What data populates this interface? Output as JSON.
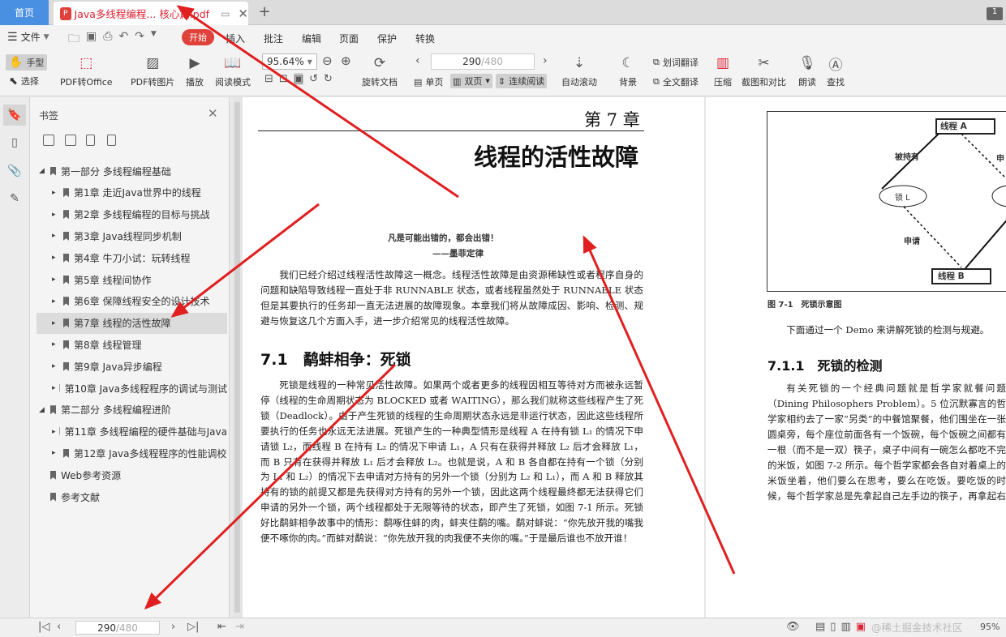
{
  "tabs": {
    "home": "首页",
    "doc_title": "Java多线程编程... 核心篇.pdf",
    "pdf_badge": "P"
  },
  "window_badge": "1",
  "menu": {
    "file": "文件",
    "items": [
      "开始",
      "插入",
      "批注",
      "编辑",
      "页面",
      "保护",
      "转换"
    ]
  },
  "toolbar": {
    "hand": "手型",
    "select": "选择",
    "pdf_to_office": "PDF转Office",
    "pdf_to_image": "PDF转图片",
    "play": "播放",
    "read_mode": "阅读模式",
    "zoom": "95.64%",
    "rotate": "旋转文档",
    "page_current": "290",
    "page_total": "/480",
    "single": "单页",
    "double": "双页",
    "continuous": "连续阅读",
    "auto_scroll": "自动滚动",
    "background": "背景",
    "word_translate": "划词翻译",
    "full_translate": "全文翻译",
    "compress": "压缩",
    "crop_compare": "截图和对比",
    "read_aloud": "朗读",
    "find": "查找"
  },
  "panel": {
    "title": "书签",
    "bookmarks": [
      {
        "label": "第一部分 多线程编程基础",
        "level": 0,
        "tri": "◢"
      },
      {
        "label": "第1章 走近Java世界中的线程",
        "level": 1,
        "tri": "▸"
      },
      {
        "label": "第2章 多线程编程的目标与挑战",
        "level": 1,
        "tri": "▸"
      },
      {
        "label": "第3章 Java线程同步机制",
        "level": 1,
        "tri": "▸"
      },
      {
        "label": "第4章 牛刀小试：玩转线程",
        "level": 1,
        "tri": "▸"
      },
      {
        "label": "第5章 线程间协作",
        "level": 1,
        "tri": "▸"
      },
      {
        "label": "第6章 保障线程安全的设计技术",
        "level": 1,
        "tri": "▸"
      },
      {
        "label": "第7章 线程的活性故障",
        "level": 1,
        "tri": "▸"
      },
      {
        "label": "第8章 线程管理",
        "level": 1,
        "tri": "▸"
      },
      {
        "label": "第9章 Java异步编程",
        "level": 1,
        "tri": "▸"
      },
      {
        "label": "第10章 Java多线程程序的调试与测试",
        "level": 1,
        "tri": "▸"
      },
      {
        "label": "第二部分 多线程编程进阶",
        "level": 0,
        "tri": "◢"
      },
      {
        "label": "第11章 多线程编程的硬件基础与Java",
        "level": 1,
        "tri": "▸"
      },
      {
        "label": "第12章 Java多线程程序的性能调校",
        "level": 1,
        "tri": "▸"
      },
      {
        "label": "Web参考资源",
        "level": 0,
        "tri": ""
      },
      {
        "label": "参考文献",
        "level": 0,
        "tri": ""
      }
    ]
  },
  "page_left": {
    "chapter": "第 7 章",
    "title": "线程的活性故障",
    "epigraph": "凡是可能出错的，都会出错！",
    "epigraph_src": "——墨菲定律",
    "intro": "我们已经介绍过线程活性故障这一概念。线程活性故障是由资源稀缺性或者程序自身的问题和缺陷导致线程一直处于非 RUNNABLE 状态，或者线程虽然处于 RUNNABLE 状态但是其要执行的任务却一直无法进展的故障现象。本章我们将从故障成因、影响、检测、规避与恢复这几个方面入手，进一步介绍常见的线程活性故障。",
    "section": "7.1　鹬蚌相争：死锁",
    "body": "死锁是线程的一种常见活性故障。如果两个或者更多的线程因相互等待对方而被永远暂停（线程的生命周期状态为 BLOCKED 或者 WAITING），那么我们就称这些线程产生了死锁（Deadlock）。由于产生死锁的线程的生命周期状态永远是非运行状态，因此这些线程所要执行的任务也永远无法进展。死锁产生的一种典型情形是线程 A 在持有锁 L₁ 的情况下申请锁 L₂，而线程 B 在持有 L₂ 的情况下申请 L₁，A 只有在获得并释放 L₂ 后才会释放 L₁，而 B 只有在获得并释放 L₁ 后才会释放 L₂。也就是说，A 和 B 各自都在持有一个锁（分别为 L₁ 和 L₂）的情况下去申请对方持有的另外一个锁（分别为 L₂ 和 L₁），而 A 和 B 释放其持有的锁的前提又都是先获得对方持有的另外一个锁，因此这两个线程最终都无法获得它们申请的另外一个锁，两个线程都处于无限等待的状态，即产生了死锁，如图 7-1 所示。死锁好比鹬蚌相争故事中的情形：鹬啄住蚌的肉，蚌夹住鹬的嘴。鹬对蚌说：“你先放开我的嘴我便不啄你的肉。”而蚌对鹬说：“你先放开我的肉我便不夹你的嘴。”于是最后谁也不放开谁！"
  },
  "page_right": {
    "diagram": {
      "thread_a": "线程 A",
      "thread_b": "线程 B",
      "lock": "锁 L",
      "held": "被持有",
      "request": "申请",
      "cut": "申"
    },
    "figure_caption": "图 7-1　死锁示意图",
    "lead": "下面通过一个 Demo 来讲解死锁的检测与规避。",
    "section": "7.1.1　死锁的检测",
    "body": "有关死锁的一个经典问题就是哲学家就餐问题（Dining Philosophers Problem）。5 位沉默寡言的哲学家相约去了一家“另类”的中餐馆聚餐，他们围坐在一张圆桌旁，每个座位前面各有一个饭碗，每个饭碗之间都有一根（而不是一双）筷子，桌子中间有一碗怎么都吃不完的米饭，如图 7-2 所示。每个哲学家都会各自对着桌上的米饭坐着，他们要么在思考，要么在吃饭。要吃饭的时候，每个哲学家总是先拿起自己左手边的筷子，再拿起右手边的筷子，一双筷子的时候哲学家才能够吃饭。哲学家吃着吃着会放下筷子，吃完毕之后又接着吃饭，如此这般地在思考与吃饭之间反复"
  },
  "status": {
    "page_current": "290",
    "page_total": "/480",
    "zoom": "95%",
    "watermark": "@稀土掘金技术社区"
  }
}
